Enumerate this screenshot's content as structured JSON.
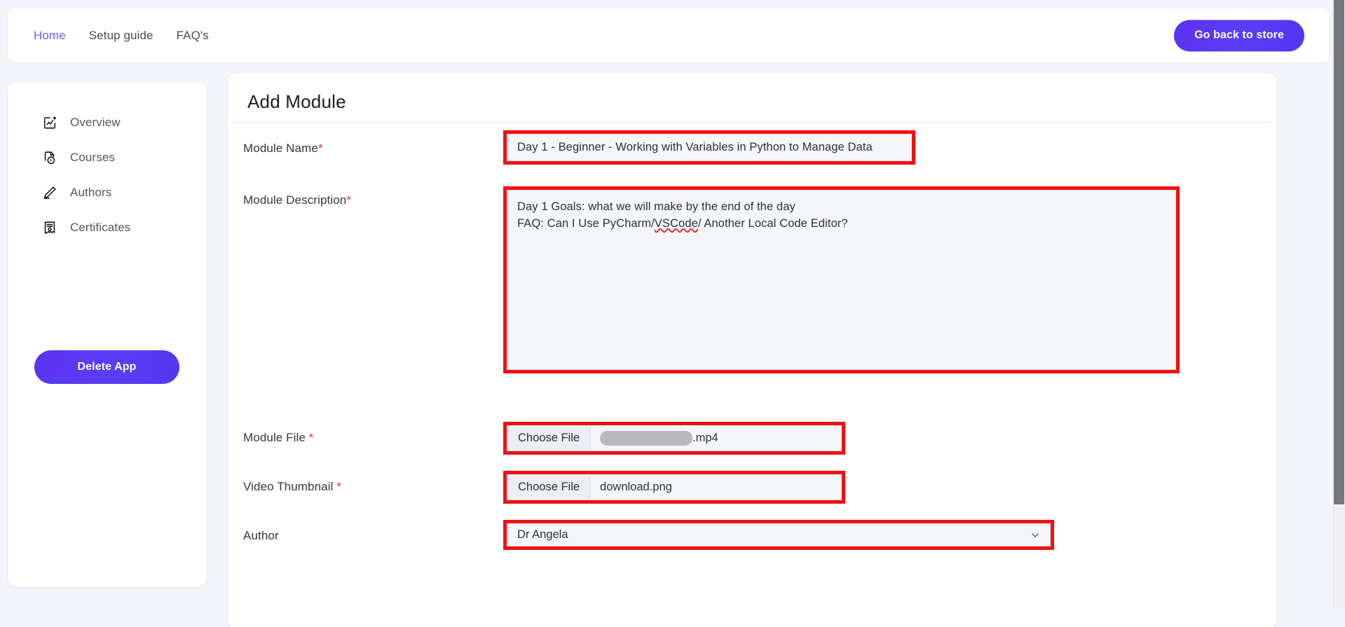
{
  "topbar": {
    "links": [
      {
        "label": "Home",
        "active": true
      },
      {
        "label": "Setup guide",
        "active": false
      },
      {
        "label": "FAQ's",
        "active": false
      }
    ],
    "store_button": "Go back to store",
    "accent_color": "#5b3df5"
  },
  "sidebar": {
    "items": [
      {
        "label": "Overview",
        "icon": "edit-square-icon"
      },
      {
        "label": "Courses",
        "icon": "video-file-icon"
      },
      {
        "label": "Authors",
        "icon": "pencil-icon"
      },
      {
        "label": "Certificates",
        "icon": "certificate-icon"
      }
    ],
    "delete_button": "Delete App"
  },
  "main": {
    "title": "Add Module",
    "fields": {
      "module_name": {
        "label": "Module Name",
        "required_mark": "*",
        "value": "Day 1 - Beginner - Working with Variables in Python to Manage Data",
        "placeholder": "Module Name"
      },
      "module_description": {
        "label": "Module Description",
        "required_mark": "*",
        "line1": "Day 1 Goals: what we will make by the end of the day",
        "line2_before": "FAQ: Can I Use PyCharm/",
        "line2_misspelled": "VSCode",
        "line2_after": "/ Another Local Code Editor?",
        "placeholder": "Module Description"
      },
      "module_file": {
        "label": "Module File ",
        "required_mark": "*",
        "button_label": "Choose File",
        "file_name_suffix": ".mp4",
        "file_name_redacted": true
      },
      "video_thumbnail": {
        "label": "Video Thumbnail ",
        "required_mark": "*",
        "button_label": "Choose File",
        "file_name": "download.png"
      },
      "author": {
        "label": "Author",
        "required_mark": "",
        "selected": "Dr Angela",
        "chevron": "chevron-down-icon"
      }
    }
  },
  "annotation": {
    "highlight_color": "#ef1212"
  }
}
